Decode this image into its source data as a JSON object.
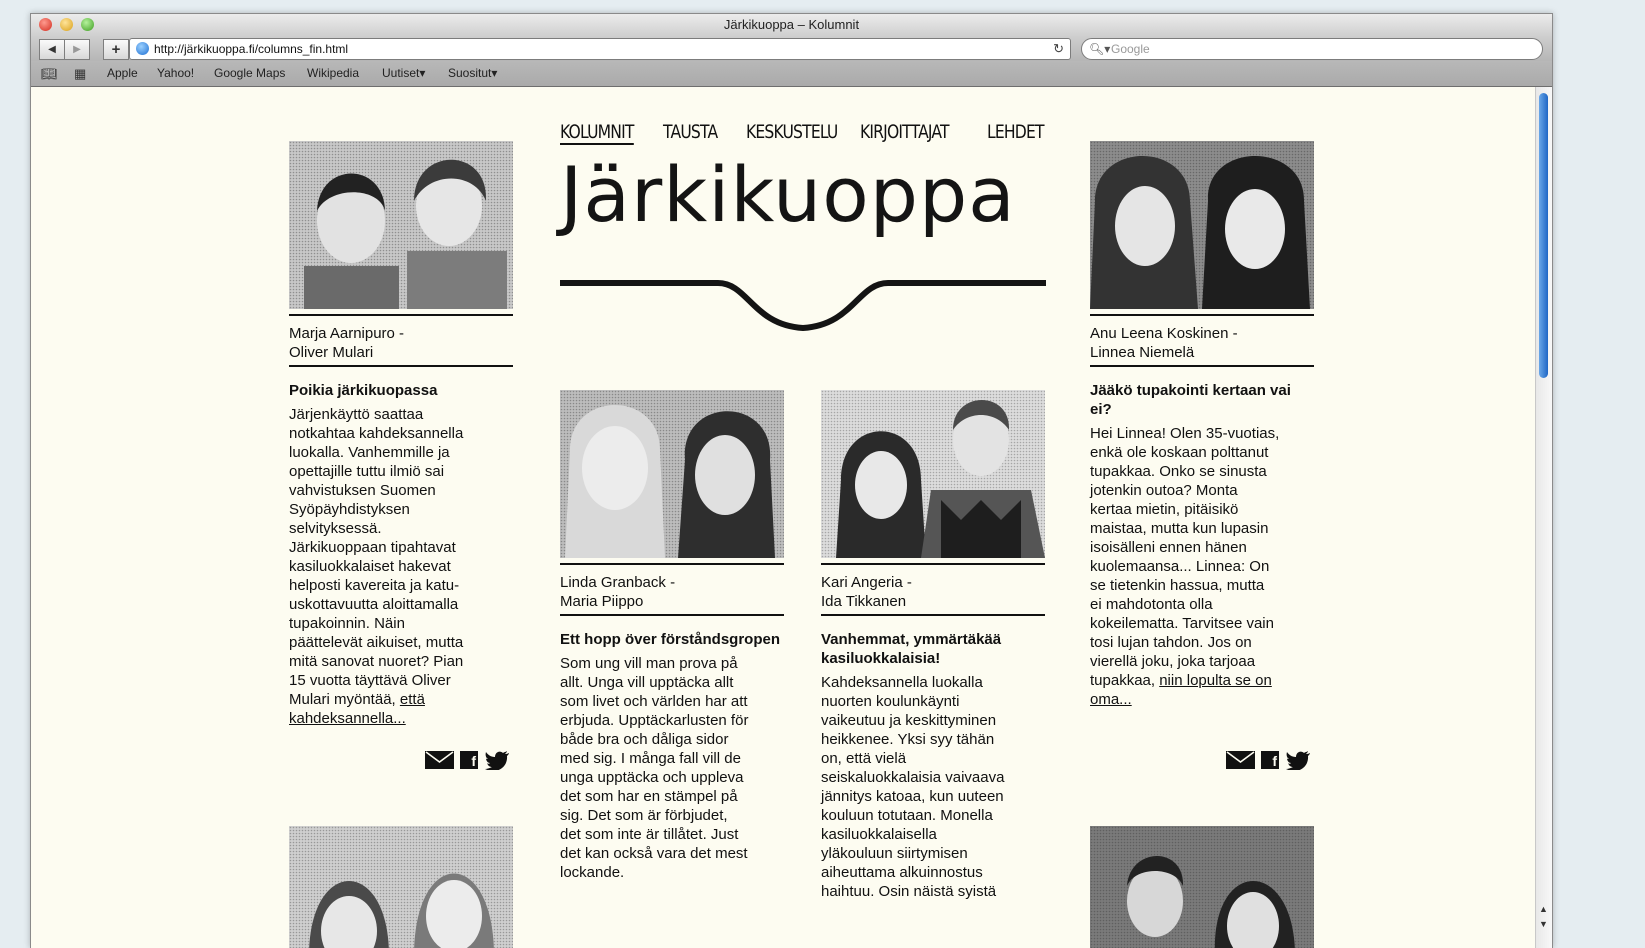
{
  "browser": {
    "window_title": "Järkikuoppa – Kolumnit",
    "url": "http://järkikuoppa.fi/columns_fin.html",
    "search_placeholder": "Google",
    "bookmarks": [
      "Apple",
      "Yahoo!",
      "Google Maps",
      "Wikipedia",
      "Uutiset▾",
      "Suositut▾"
    ],
    "icons": {
      "back": "back-arrow-icon",
      "forward": "forward-arrow-icon",
      "add": "plus-icon",
      "reload": "reload-icon",
      "bookmarks": "book-icon",
      "top_sites": "grid-icon"
    }
  },
  "site": {
    "logo": "Järkikuoppa",
    "nav": [
      "KOLUMNIT",
      "TAUSTA",
      "KESKUSTELU",
      "KIRJOITTAJAT",
      "LEHDET"
    ],
    "active_nav": "KOLUMNIT"
  },
  "columns": [
    {
      "authors_line1": "Marja Aarnipuro -",
      "authors_line2": "Oliver Mulari",
      "title": "Poikia järkikuopassa",
      "body": "Järjenkäyttö saattaa notkahtaa kahdeksannella luokalla. Vanhemmille ja opettajille tuttu ilmiö sai vahvistuksen Suomen Syöpäyhdistyksen selvityksessä. Järkikuoppaan tipahtavat kasiluokkalaiset hakevat helposti kavereita ja katu-uskottavuutta aloittamalla tupakoinnin. Näin päättelevät aikuiset, mutta mitä sanovat nuoret? Pian 15 vuotta täyttävä Oliver Mulari myöntää,",
      "link": "että kahdeksannella..."
    },
    {
      "authors_line1": "Linda Granback -",
      "authors_line2": "Maria Piippo",
      "title": "Ett hopp över förståndsgropen",
      "body": "Som ung vill man prova på allt. Unga vill upptäcka allt som livet och världen har att erbjuda. Upptäckarlusten för både bra och dåliga sidor med sig. I många fall vill de unga upptäcka och uppleva det som har en stämpel på sig. Det som är förbjudet, det som inte är tillåtet. Just det kan också vara det mest lockande.",
      "link": ""
    },
    {
      "authors_line1": "Kari Angeria -",
      "authors_line2": "Ida Tikkanen",
      "title": "Vanhemmat, ymmärtäkää kasiluokkalaisia!",
      "body": "Kahdeksannella luokalla nuorten koulunkäynti vaikeutuu ja keskittyminen heikkenee. Yksi syy tähän on, että vielä seiskaluokkalaisia vaivaava jännitys katoaa, kun uuteen kouluun totutaan. Monella kasiluokkalaisella yläkouluun siirtymisen aiheuttama alkuinnostus haihtuu. Osin näistä syistä",
      "link": ""
    },
    {
      "authors_line1": "Anu Leena Koskinen -",
      "authors_line2": "Linnea Niemelä",
      "title": "Jääkö tupakointi kertaan vai ei?",
      "body": "Hei Linnea! Olen 35-vuotias, enkä ole koskaan polttanut tupakkaa. Onko se sinusta jotenkin outoa? Monta kertaa mietin, pitäisikö maistaa, mutta kun lupasin isoisälleni ennen hänen kuolemaansa... Linnea: On se tietenkin hassua, mutta ei mahdotonta olla kokeilematta. Tarvitsee vain tosi lujan tahdon. Jos on vierellä joku, joka tarjoaa tupakkaa,",
      "link": "niin lopulta se on oma..."
    }
  ],
  "share_icons": [
    "mail-icon",
    "facebook-icon",
    "twitter-icon"
  ]
}
